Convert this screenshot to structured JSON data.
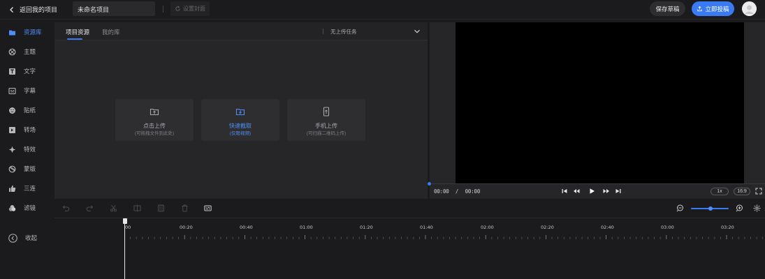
{
  "topbar": {
    "back_label": "返回我的项目",
    "project_title": "未命名项目",
    "cover_label": "设置封面",
    "save_draft_label": "保存草稿",
    "publish_label": "立即投稿"
  },
  "sidebar": {
    "items": [
      {
        "label": "资源库",
        "icon": "folder-icon",
        "active": true
      },
      {
        "label": "主题",
        "icon": "theme-icon"
      },
      {
        "label": "文字",
        "icon": "text-icon"
      },
      {
        "label": "字幕",
        "icon": "subtitle-icon"
      },
      {
        "label": "贴纸",
        "icon": "sticker-icon"
      },
      {
        "label": "转场",
        "icon": "transition-icon"
      },
      {
        "label": "特效",
        "icon": "effect-icon"
      },
      {
        "label": "蒙版",
        "icon": "mask-icon"
      },
      {
        "label": "三连",
        "icon": "thumbs-up-icon"
      },
      {
        "label": "滤镜",
        "icon": "filter-icon"
      }
    ],
    "collapse_label": "收起"
  },
  "panel": {
    "tabs": [
      {
        "label": "项目资源",
        "active": true
      },
      {
        "label": "我的库",
        "active": false
      }
    ],
    "upload_task_label": "无上传任务",
    "cards": [
      {
        "title": "点击上传",
        "subtitle": "(可拖拽文件到此处)",
        "icon": "upload-icon"
      },
      {
        "title": "快速截取",
        "subtitle": "(仅限视频)",
        "icon": "folder-bolt-icon",
        "accent": true
      },
      {
        "title": "手机上传",
        "subtitle": "(可扫描二维码上传)",
        "icon": "phone-upload-icon"
      }
    ]
  },
  "preview": {
    "current_time": "00:00",
    "separator": "/",
    "total_time": "00:00",
    "speed": "1x",
    "aspect_ratio": "16:9"
  },
  "timeline": {
    "zoom_level": 0.5,
    "ruler_labels": [
      "00",
      "00:20",
      "00:40",
      "01:00",
      "01:20",
      "01:40",
      "02:00",
      "02:20",
      "02:40",
      "03:00",
      "03:20"
    ]
  },
  "colors": {
    "accent": "#3a7af2",
    "background": "#1b1b1d",
    "panel": "#262629"
  }
}
